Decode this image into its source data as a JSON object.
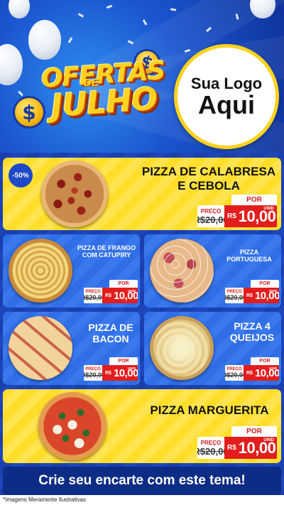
{
  "header": {
    "title_line1": "OFERTAS",
    "title_line2": "DE",
    "title_line3": "JULHO",
    "coin_symbol": "$",
    "logo_line1": "Sua Logo",
    "logo_line2": "Aqui"
  },
  "colors": {
    "brand_blue": "#1b3fae",
    "accent_yellow": "#ffd21f",
    "price_red": "#e31d1d"
  },
  "products": [
    {
      "name": "PIZZA DE CALABRESA E CEBOLA",
      "discount_badge": "-50%",
      "price_label": "PREÇO",
      "old_price": "R$20,00",
      "por_label": "POR",
      "currency": "R$",
      "price": "10,00",
      "unit": "UNID"
    },
    {
      "name": "PIZZA DE FRANGO COM CATUPIRY",
      "price_label": "PREÇO",
      "old_price": "R$20,00",
      "por_label": "POR",
      "currency": "R$",
      "price": "10,00",
      "unit": "UNID"
    },
    {
      "name": "PIZZA PORTUGUESA",
      "price_label": "PREÇO",
      "old_price": "R$20,00",
      "por_label": "POR",
      "currency": "R$",
      "price": "10,00",
      "unit": "UNID"
    },
    {
      "name": "PIZZA DE BACON",
      "price_label": "PREÇO",
      "old_price": "R$20,00",
      "por_label": "POR",
      "currency": "R$",
      "price": "10,00",
      "unit": "UNID"
    },
    {
      "name": "PIZZA 4 QUEIJOS",
      "price_label": "PREÇO",
      "old_price": "R$20,00",
      "por_label": "POR",
      "currency": "R$",
      "price": "10,00",
      "unit": "UNID"
    },
    {
      "name": "PIZZA MARGUERITA",
      "price_label": "PREÇO",
      "old_price": "R$20,00",
      "por_label": "POR",
      "currency": "R$",
      "price": "10,00",
      "unit": "UNID"
    }
  ],
  "cta": "Crie seu encarte com este tema!",
  "disclaimer": "*Imagens Meramente Ilustrativas"
}
